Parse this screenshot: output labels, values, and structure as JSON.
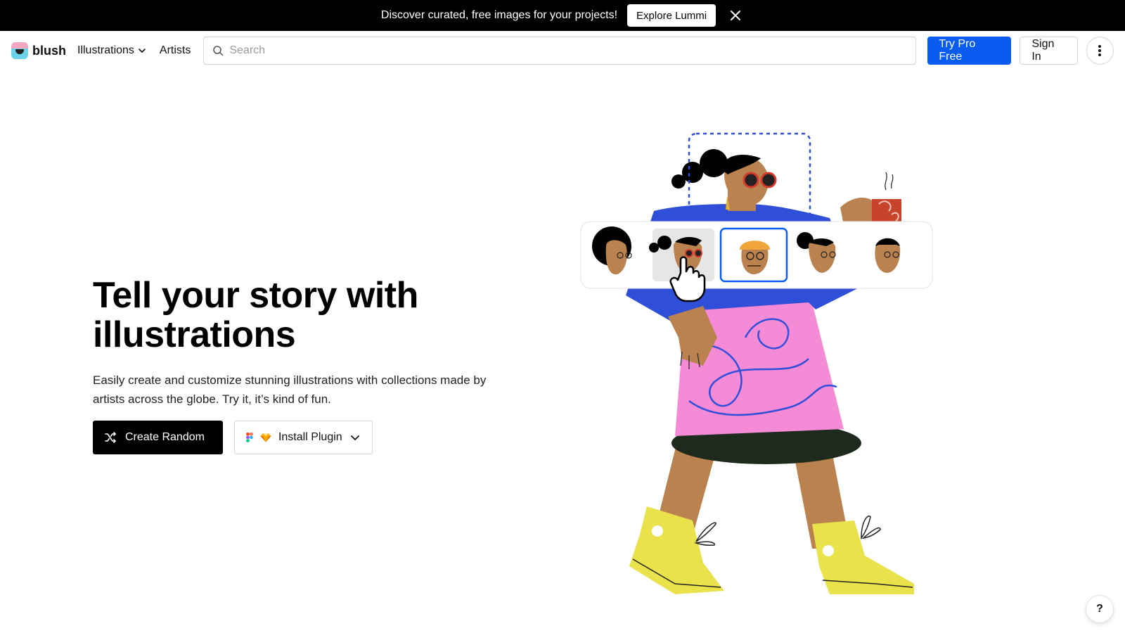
{
  "banner": {
    "text": "Discover curated, free images for your projects!",
    "button_label": "Explore Lummi"
  },
  "header": {
    "logo_text": "blush",
    "nav": [
      {
        "label": "Illustrations"
      },
      {
        "label": "Artists"
      }
    ],
    "search_placeholder": "Search",
    "try_pro_label": "Try Pro Free",
    "sign_in_label": "Sign In"
  },
  "hero": {
    "title": "Tell your story with illustrations",
    "subtitle": "Easily create and customize stunning illustrations with collections made by artists across the globe. Try it, it’s kind of fun.",
    "create_random_label": "Create Random",
    "install_plugin_label": "Install Plugin"
  },
  "help_label": "?",
  "colors": {
    "primary_blue": "#0a5cf0",
    "banner_bg": "#000000",
    "shirt_blue": "#2f4fd8",
    "skirt_pink": "#f58ad6",
    "shoe_yellow": "#e9e24a",
    "skin": "#b9824f"
  },
  "icons": [
    "close-icon",
    "chevron-down-icon",
    "search-icon",
    "more-vertical-icon",
    "shuffle-icon",
    "figma-icon",
    "sketch-icon",
    "cursor-hand-icon"
  ]
}
